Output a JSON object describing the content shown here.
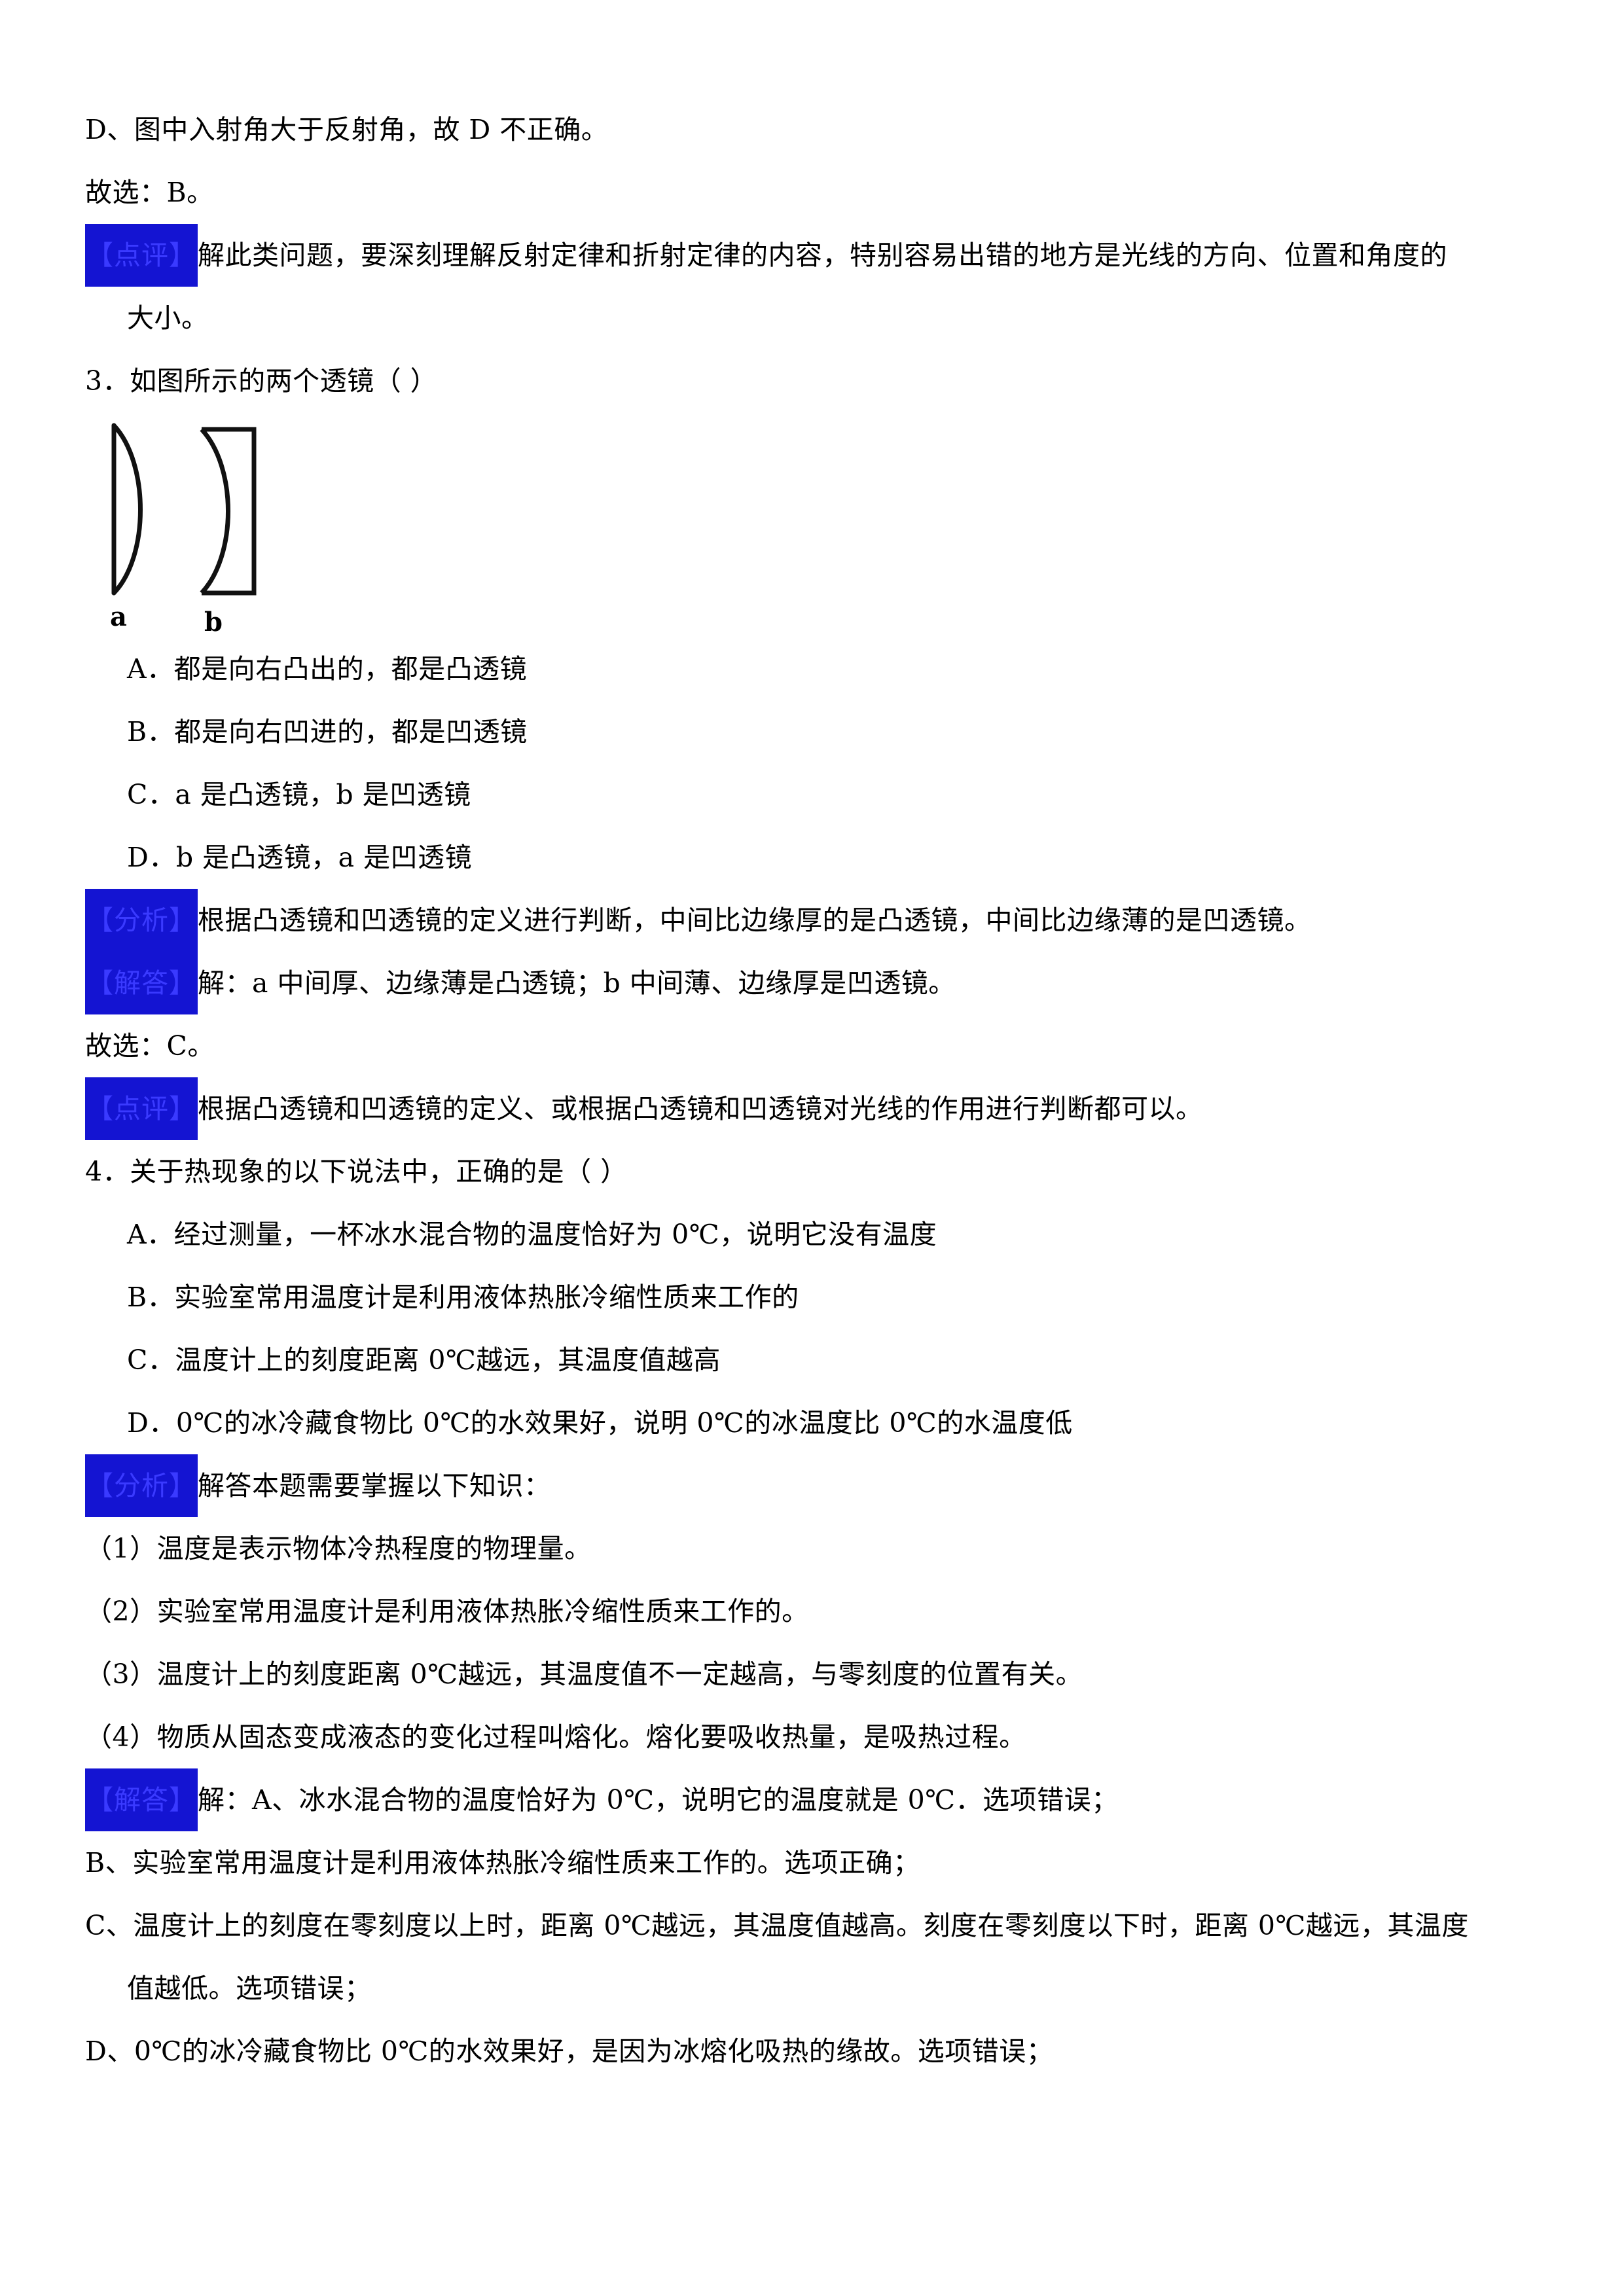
{
  "document": {
    "language": "zh-CN",
    "type": "physics-exam-answer-key",
    "accent_color": "#1414d2",
    "accent_text_color": "#3a3aff"
  },
  "labels": {
    "analysis": "【分析】",
    "solution": "【解答】",
    "comment": "【点评】"
  },
  "blocks": {
    "q2_tail": {
      "option_d": "D、图中入射角大于反射角，故 D 不正确。",
      "answer": "故选：B。",
      "comment_line1": "解此类问题，要深刻理解反射定律和折射定律的内容，特别容易出错的地方是光线的方向、位置和角度的",
      "comment_line2": "大小。"
    },
    "q3": {
      "number": "3．",
      "stem": "如图所示的两个透镜（      ）",
      "figure": {
        "lens_a_label": "a",
        "lens_a_type": "plano-convex",
        "lens_b_label": "b",
        "lens_b_type": "concave"
      },
      "options": [
        "A．都是向右凸出的，都是凸透镜",
        "B．都是向右凹进的，都是凹透镜",
        "C．a 是凸透镜，b 是凹透镜",
        "D．b 是凸透镜，a 是凹透镜"
      ],
      "analysis": "根据凸透镜和凹透镜的定义进行判断，中间比边缘厚的是凸透镜，中间比边缘薄的是凹透镜。",
      "solution": "解：a 中间厚、边缘薄是凸透镜；b 中间薄、边缘厚是凹透镜。",
      "answer": "故选：C。",
      "comment": "根据凸透镜和凹透镜的定义、或根据凸透镜和凹透镜对光线的作用进行判断都可以。"
    },
    "q4": {
      "number": "4．",
      "stem": "关于热现象的以下说法中，正确的是（      ）",
      "options": [
        "A．经过测量，一杯冰水混合物的温度恰好为 0℃，说明它没有温度",
        "B．实验室常用温度计是利用液体热胀冷缩性质来工作的",
        "C．温度计上的刻度距离 0℃越远，其温度值越高",
        "D．0℃的冰冷藏食物比 0℃的水效果好，说明 0℃的冰温度比 0℃的水温度低"
      ],
      "analysis_intro": "解答本题需要掌握以下知识：",
      "analysis_points": [
        "（1）温度是表示物体冷热程度的物理量。",
        "（2）实验室常用温度计是利用液体热胀冷缩性质来工作的。",
        "（3）温度计上的刻度距离 0℃越远，其温度值不一定越高，与零刻度的位置有关。",
        "（4）物质从固态变成液态的变化过程叫熔化。熔化要吸收热量，是吸热过程。"
      ],
      "solution_first": "解：A、冰水混合物的温度恰好为 0℃，说明它的温度就是 0℃．选项错误；",
      "solution_lines": [
        "B、实验室常用温度计是利用液体热胀冷缩性质来工作的。选项正确；",
        "C、温度计上的刻度在零刻度以上时，距离 0℃越远，其温度值越高。刻度在零刻度以下时，距离 0℃越远，其温度",
        "值越低。选项错误；",
        "D、0℃的冰冷藏食物比 0℃的水效果好，是因为冰熔化吸热的缘故。选项错误；"
      ]
    }
  }
}
